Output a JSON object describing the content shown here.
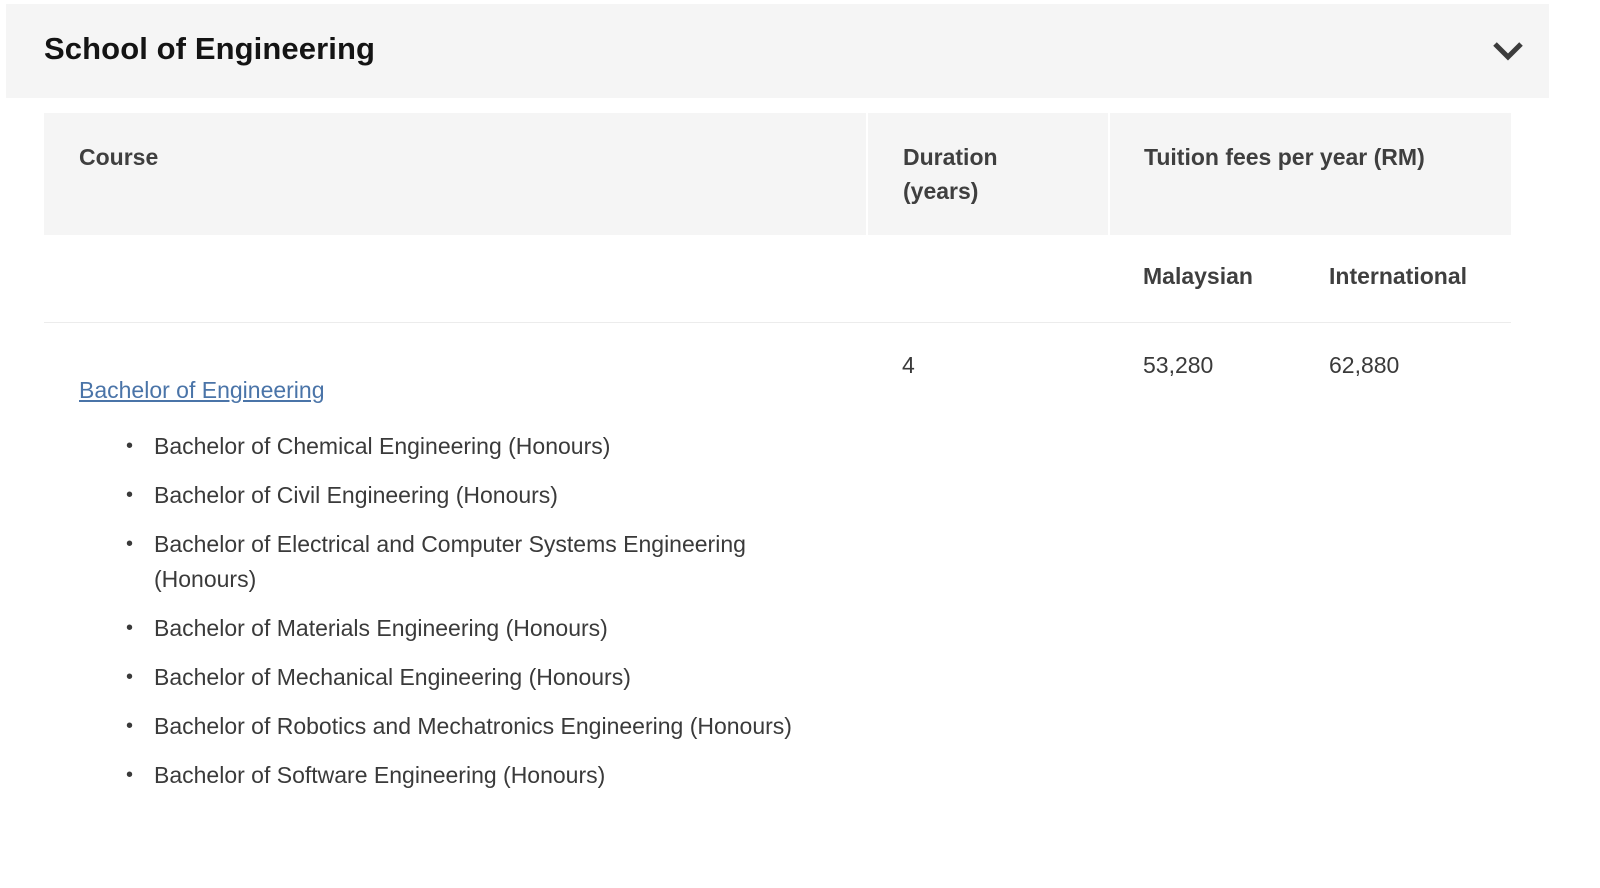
{
  "section": {
    "title": "School of Engineering",
    "toggle_icon": "chevron-down-icon"
  },
  "table": {
    "headers": {
      "course": "Course",
      "duration": "Duration (years)",
      "fees": "Tuition fees per year (RM)"
    },
    "subheaders": {
      "malaysian": "Malaysian",
      "international": "International"
    },
    "rows": [
      {
        "course_link": "Bachelor of Engineering",
        "duration": "4",
        "malaysian": "53,280",
        "international": "62,880",
        "programmes": [
          "Bachelor of Chemical Engineering (Honours)",
          "Bachelor of Civil Engineering (Honours)",
          "Bachelor of Electrical and Computer Systems Engineering (Honours)",
          "Bachelor of Materials Engineering (Honours)",
          "Bachelor of Mechanical Engineering (Honours)",
          "Bachelor of Robotics and Mechatronics Engineering (Honours)",
          "Bachelor of Software Engineering (Honours)"
        ]
      }
    ]
  },
  "colors": {
    "header_bg": "#f5f5f5",
    "link": "#4a74a8",
    "title": "#141414",
    "text": "#3a3a3a"
  }
}
